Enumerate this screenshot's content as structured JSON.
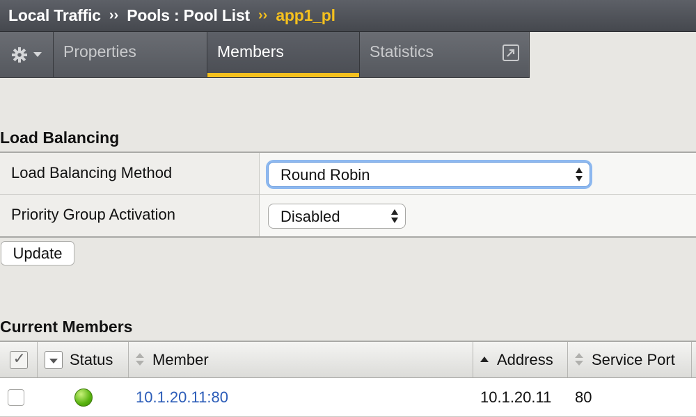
{
  "breadcrumb": {
    "items": [
      "Local Traffic",
      "Pools : Pool List"
    ],
    "separator": "››",
    "current": "app1_pl"
  },
  "tabs": {
    "items": [
      {
        "label": "Properties"
      },
      {
        "label": "Members"
      },
      {
        "label": "Statistics"
      }
    ],
    "active": "Members"
  },
  "load_balancing": {
    "title": "Load Balancing",
    "rows": [
      {
        "label": "Load Balancing Method",
        "value": "Round Robin"
      },
      {
        "label": "Priority Group Activation",
        "value": "Disabled"
      }
    ],
    "update_label": "Update"
  },
  "members": {
    "title": "Current Members",
    "columns": [
      "Status",
      "Member",
      "Address",
      "Service Port"
    ],
    "rows": [
      {
        "status": "green",
        "member": "10.1.20.11:80",
        "address": "10.1.20.11",
        "port": "80"
      }
    ]
  },
  "colors": {
    "accent": "#f4c01e",
    "link": "#2b5cb8",
    "header_bg": "#55585e"
  }
}
